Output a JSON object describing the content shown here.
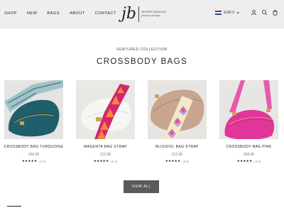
{
  "nav": {
    "items": [
      {
        "label": "SHOP"
      },
      {
        "label": "NEW"
      },
      {
        "label": "BAGS"
      },
      {
        "label": "ABOUT"
      },
      {
        "label": "CONTACT"
      }
    ]
  },
  "brand": {
    "monogram": "jb",
    "name": "JESPER BROOKS",
    "tagline": "jewelry design"
  },
  "header_right": {
    "currency": "EUR €",
    "icons": [
      "flag-netherlands-icon",
      "chevron-down-icon",
      "account-icon",
      "search-icon",
      "cart-icon"
    ]
  },
  "section": {
    "eyebrow": "FEATURED COLLECTION",
    "title": "CROSSBODY BAGS"
  },
  "products": [
    {
      "name": "CROSSBODY BAG TURQUOISE",
      "price": "€39,95",
      "stars": "★★★★★",
      "count": "(4.9)",
      "bag_color": "#1f5f6b",
      "strap_primary": "#9ec3c9",
      "strap_secondary": "#5e7f86"
    },
    {
      "name": "MAGENTA BAG STRAP",
      "price": "€12,95",
      "stars": "★★★★★",
      "count": "(5.0)",
      "bag_color": "#f1f1ee",
      "strap_primary": "#d4266f",
      "strap_secondary": "#f08a3a"
    },
    {
      "name": "BLISSFUL BAG STRAP",
      "price": "€12,95",
      "stars": "★★★★★",
      "count": "(5.0)",
      "bag_color": "#c8a58e",
      "strap_primary": "#b8a4dd",
      "strap_secondary": "#f4e8c8"
    },
    {
      "name": "CROSSBODY BAG PINK",
      "price": "€39,95",
      "stars": "★★★★★",
      "count": "(4.8)",
      "bag_color": "#e0369a",
      "strap_primary": "#e85aa8",
      "strap_secondary": "#c72a87"
    }
  ],
  "cta": {
    "label": "VIEW ALL"
  },
  "colors": {
    "header_bg": "#eeeeee",
    "button_bg": "#5a5a5a",
    "text": "#222222"
  }
}
